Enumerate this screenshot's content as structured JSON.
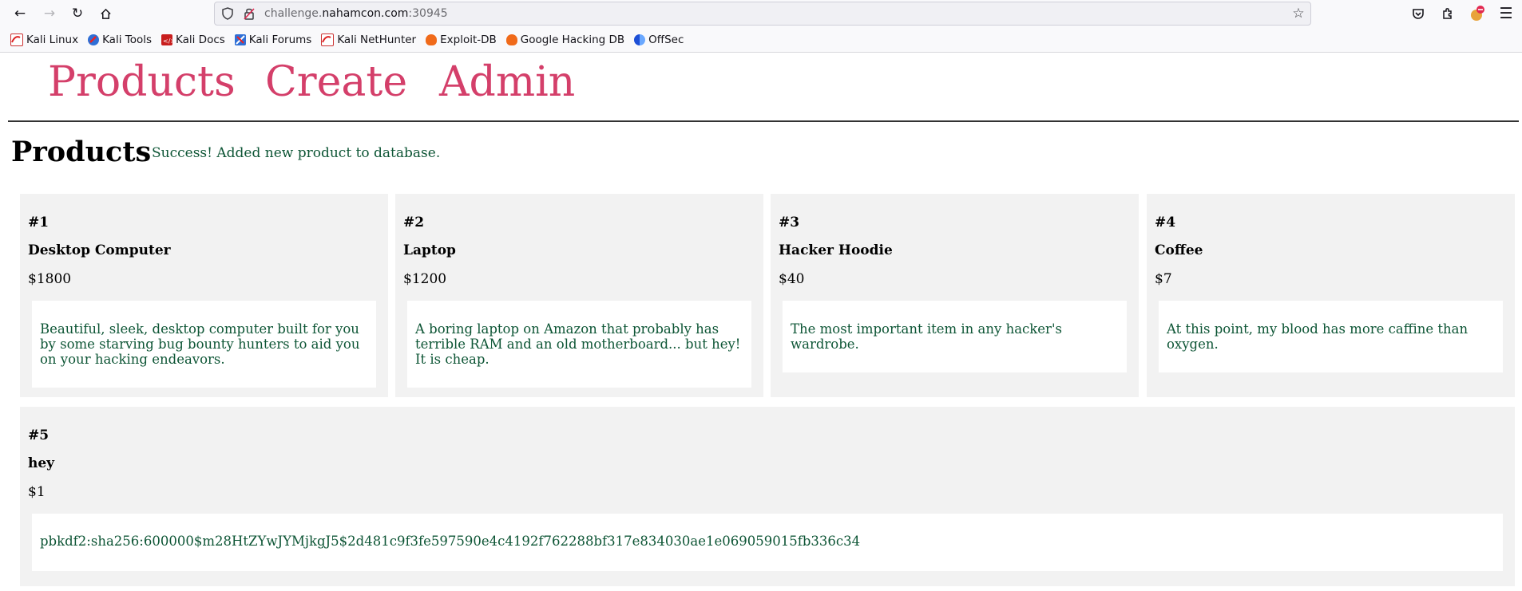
{
  "browser": {
    "url_host_prefix": "challenge.",
    "url_host_main": "nahamcon.com",
    "url_port": ":30945",
    "bookmarks": [
      {
        "label": "Kali Linux",
        "icon": "kali-dragon-icon"
      },
      {
        "label": "Kali Tools",
        "icon": "kali-tools-icon"
      },
      {
        "label": "Kali Docs",
        "icon": "kali-docs-icon"
      },
      {
        "label": "Kali Forums",
        "icon": "kali-forums-icon"
      },
      {
        "label": "Kali NetHunter",
        "icon": "kali-nethunter-icon"
      },
      {
        "label": "Exploit-DB",
        "icon": "exploit-db-icon"
      },
      {
        "label": "Google Hacking DB",
        "icon": "ghdb-icon"
      },
      {
        "label": "OffSec",
        "icon": "offsec-icon"
      }
    ]
  },
  "nav": {
    "products": "Products",
    "create": "Create",
    "admin": "Admin"
  },
  "page": {
    "heading": "Products",
    "flash": "Success! Added new product to database."
  },
  "products": [
    {
      "id": "#1",
      "name": "Desktop Computer",
      "price": "$1800",
      "description": "Beautiful, sleek, desktop computer built for you by some starving bug bounty hunters to aid you on your hacking endeavors."
    },
    {
      "id": "#2",
      "name": "Laptop",
      "price": "$1200",
      "description": "A boring laptop on Amazon that probably has terrible RAM and an old motherboard... but hey! It is cheap."
    },
    {
      "id": "#3",
      "name": "Hacker Hoodie",
      "price": "$40",
      "description": "The most important item in any hacker's wardrobe."
    },
    {
      "id": "#4",
      "name": "Coffee",
      "price": "$7",
      "description": "At this point, my blood has more caffine than oxygen."
    },
    {
      "id": "#5",
      "name": "hey",
      "price": "$1",
      "description": "pbkdf2:sha256:600000$m28HtZYwJYMjkgJ5$2d481c9f3fe597590e4c4192f762288bf317e834030ae1e069059015fb336c34"
    }
  ],
  "colors": {
    "nav_link": "#d43f6a",
    "flash_text": "#0d5535",
    "description_text": "#0d5535",
    "card_bg": "#f2f2f2"
  }
}
